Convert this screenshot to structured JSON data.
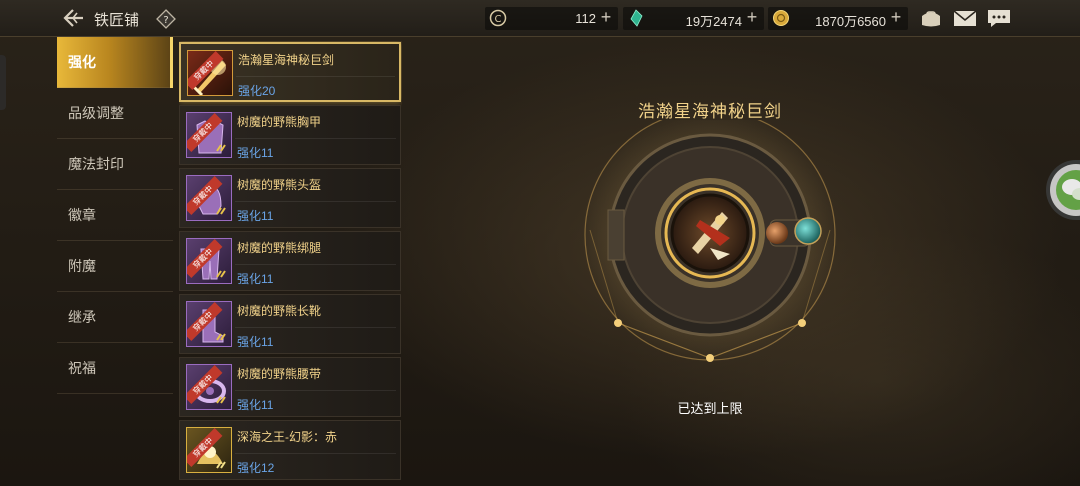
{
  "header": {
    "title": "铁匠铺",
    "back_icon": "back-arrow-icon",
    "help_icon": "help-diamond-icon",
    "currencies": [
      {
        "name": "currency-c",
        "icon": "c-coin-icon",
        "value": "112"
      },
      {
        "name": "currency-gem",
        "icon": "green-gem-icon",
        "value": "19万2474"
      },
      {
        "name": "currency-gold",
        "icon": "gold-coin-icon",
        "value": "1870万6560"
      }
    ],
    "plus_symbol": "+",
    "icons": [
      "bag-icon",
      "mail-icon",
      "chat-icon"
    ]
  },
  "menu": {
    "items": [
      {
        "label": "强化",
        "active": true
      },
      {
        "label": "品级调整",
        "active": false
      },
      {
        "label": "魔法封印",
        "active": false
      },
      {
        "label": "徽章",
        "active": false
      },
      {
        "label": "附魔",
        "active": false
      },
      {
        "label": "继承",
        "active": false
      },
      {
        "label": "祝福",
        "active": false
      }
    ]
  },
  "equipment": [
    {
      "name": "浩瀚星海神秘巨剑",
      "level": "强化20",
      "selected": true,
      "frame": "red",
      "tag": "穿戴中"
    },
    {
      "name": "树魔的野熊胸甲",
      "level": "强化11",
      "selected": false,
      "frame": "purple",
      "tag": "穿戴中"
    },
    {
      "name": "树魔的野熊头盔",
      "level": "强化11",
      "selected": false,
      "frame": "purple",
      "tag": "穿戴中"
    },
    {
      "name": "树魔的野熊绑腿",
      "level": "强化11",
      "selected": false,
      "frame": "purple",
      "tag": "穿戴中"
    },
    {
      "name": "树魔的野熊长靴",
      "level": "强化11",
      "selected": false,
      "frame": "purple",
      "tag": "穿戴中"
    },
    {
      "name": "树魔的野熊腰带",
      "level": "强化11",
      "selected": false,
      "frame": "purple",
      "tag": "穿戴中"
    },
    {
      "name": "深海之王-幻影：赤",
      "level": "强化12",
      "selected": false,
      "frame": "gold",
      "tag": "穿戴中"
    }
  ],
  "detail": {
    "item_name": "浩瀚星海神秘巨剑",
    "status": "已达到上限"
  },
  "colors": {
    "accent_gold": "#e8b83a",
    "item_name": "#f1d28a",
    "level_blue": "#6aa4e6"
  }
}
